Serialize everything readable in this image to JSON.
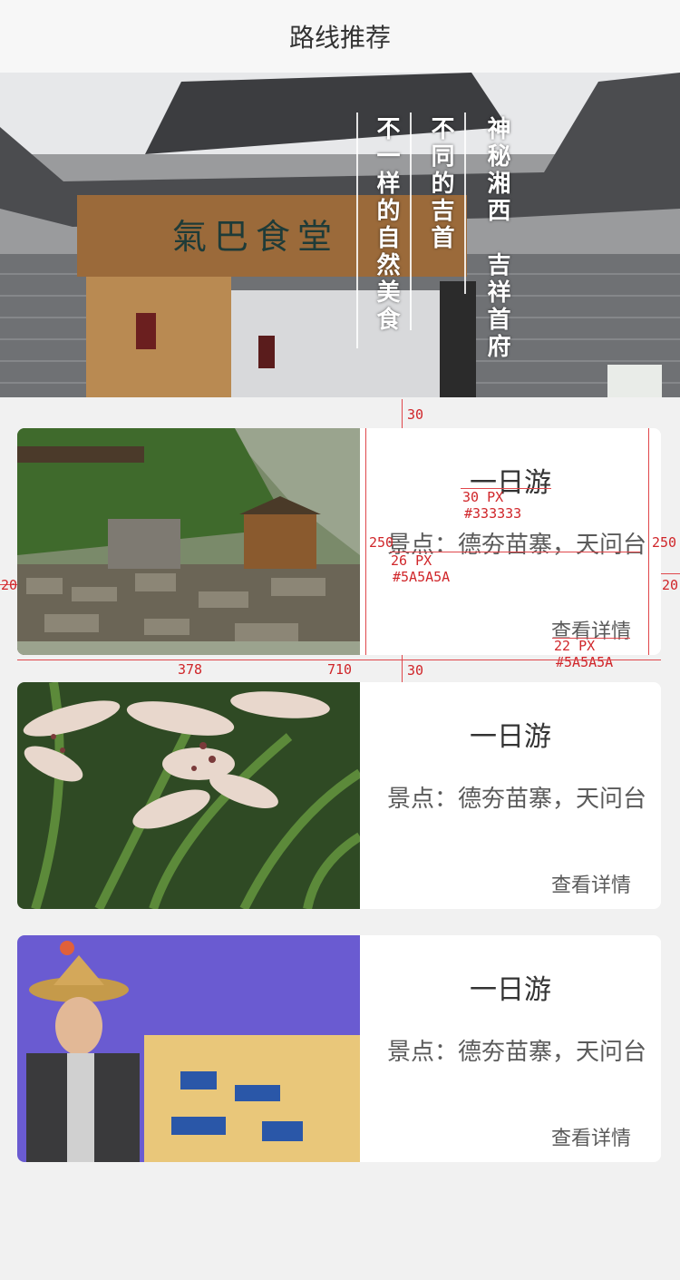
{
  "header": {
    "title": "路线推荐"
  },
  "hero": {
    "columns": [
      "神秘湘西　吉祥首府",
      "不同的吉首",
      "不一样的自然美食"
    ],
    "signboard": "氣巴食堂"
  },
  "cards": [
    {
      "title": "一日游",
      "spots": "景点：德夯苗寨，天问台",
      "detail": "查看详情"
    },
    {
      "title": "一日游",
      "spots": "景点：德夯苗寨，天问台",
      "detail": "查看详情"
    },
    {
      "title": "一日游",
      "spots": "景点：德夯苗寨，天问台",
      "detail": "查看详情"
    }
  ],
  "annotations": {
    "gap_top": "30",
    "gap_bottom": "30",
    "title_size": "30 PX",
    "title_color": "#333333",
    "spots_size": "26 PX",
    "spots_color": "#5A5A5A",
    "detail_size": "22 PX",
    "detail_color": "#5A5A5A",
    "height_left": "250",
    "height_right": "250",
    "margin_left": "20",
    "margin_right": "20",
    "image_width": "378",
    "card_width": "710"
  },
  "colors": {
    "title": "#333333",
    "text": "#5A5A5A",
    "annotation": "#d0262a"
  }
}
